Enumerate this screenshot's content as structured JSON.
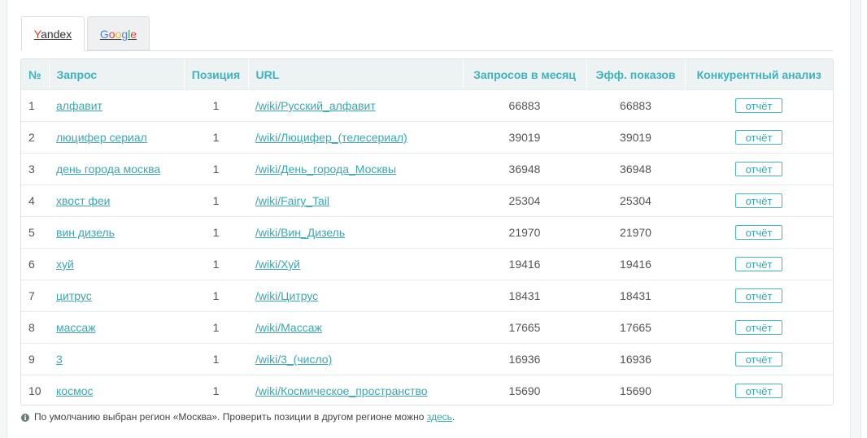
{
  "tabs": {
    "yandex_first": "Y",
    "yandex_rest": "andex",
    "google": [
      "G",
      "o",
      "o",
      "g",
      "l",
      "e"
    ]
  },
  "table": {
    "headers": [
      "№",
      "Запрос",
      "Позиция",
      "URL",
      "Запросов в месяц",
      "Эфф. показов",
      "Конкурентный анализ"
    ],
    "rows": [
      {
        "n": "1",
        "query": "алфавит",
        "pos": "1",
        "url": "/wiki/Русский_алфавит",
        "monthly": "66883",
        "eff": "66883",
        "report": "отчёт"
      },
      {
        "n": "2",
        "query": "люцифер сериал",
        "pos": "1",
        "url": "/wiki/Люцифер_(телесериал)",
        "monthly": "39019",
        "eff": "39019",
        "report": "отчёт"
      },
      {
        "n": "3",
        "query": "день города москва",
        "pos": "1",
        "url": "/wiki/День_города_Москвы",
        "monthly": "36948",
        "eff": "36948",
        "report": "отчёт"
      },
      {
        "n": "4",
        "query": "хвост феи",
        "pos": "1",
        "url": "/wiki/Fairy_Tail",
        "monthly": "25304",
        "eff": "25304",
        "report": "отчёт"
      },
      {
        "n": "5",
        "query": "вин дизель",
        "pos": "1",
        "url": "/wiki/Вин_Дизель",
        "monthly": "21970",
        "eff": "21970",
        "report": "отчёт"
      },
      {
        "n": "6",
        "query": "хуй",
        "pos": "1",
        "url": "/wiki/Хуй",
        "monthly": "19416",
        "eff": "19416",
        "report": "отчёт"
      },
      {
        "n": "7",
        "query": "цитрус",
        "pos": "1",
        "url": "/wiki/Цитрус",
        "monthly": "18431",
        "eff": "18431",
        "report": "отчёт"
      },
      {
        "n": "8",
        "query": "массаж",
        "pos": "1",
        "url": "/wiki/Массаж",
        "monthly": "17665",
        "eff": "17665",
        "report": "отчёт"
      },
      {
        "n": "9",
        "query": "3",
        "pos": "1",
        "url": "/wiki/3_(число)",
        "monthly": "16936",
        "eff": "16936",
        "report": "отчёт"
      },
      {
        "n": "10",
        "query": "космос",
        "pos": "1",
        "url": "/wiki/Космическое_пространство",
        "monthly": "15690",
        "eff": "15690",
        "report": "отчёт"
      }
    ]
  },
  "note": {
    "icon": "info-icon",
    "text": "По умолчанию выбран регион «Москва». Проверить позиции в другом регионе можно ",
    "link": "здесь",
    "end": "."
  },
  "colors": {
    "accent": "#3cb3be",
    "header_bg": "#edf3f3",
    "yandex_red": "#e5322d"
  }
}
